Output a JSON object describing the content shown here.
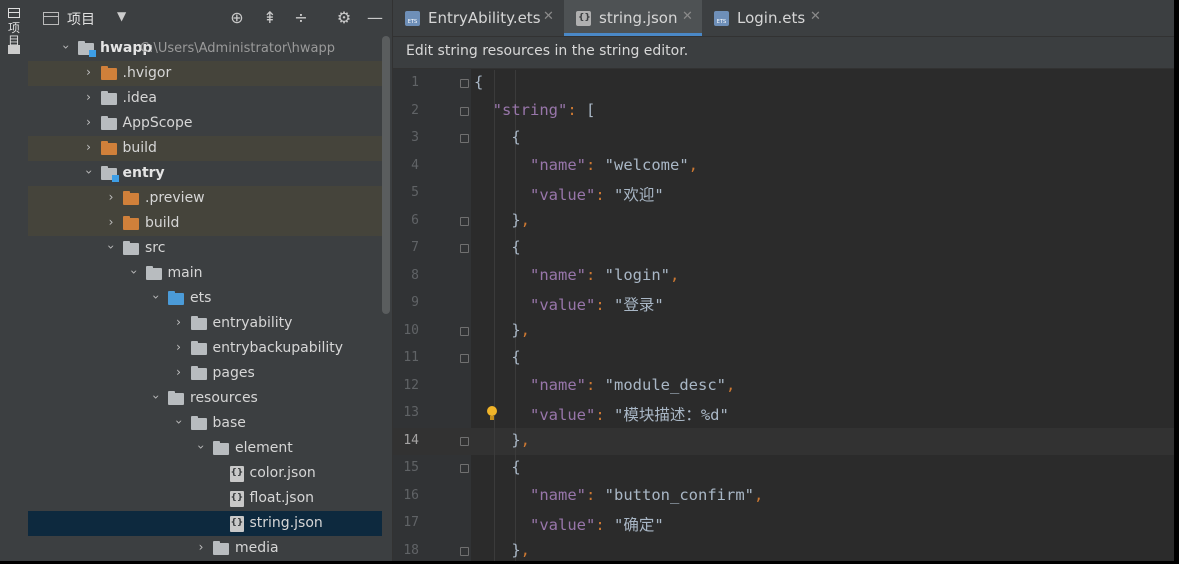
{
  "tool_strip": {
    "label": "项目"
  },
  "project_panel": {
    "title": "项目",
    "toolbar": [
      {
        "name": "locate-icon",
        "glyph": "⊕"
      },
      {
        "name": "expand-all-icon",
        "glyph": "⇞"
      },
      {
        "name": "collapse-all-icon",
        "glyph": "÷"
      },
      {
        "name": "settings-gear-icon",
        "glyph": "⚙"
      },
      {
        "name": "hide-panel-icon",
        "glyph": "—"
      }
    ],
    "tree": [
      {
        "label": "hwapp",
        "path": "C:\\Users\\Administrator\\hwapp",
        "depth": 0,
        "open": true,
        "icon": "mod",
        "bold": true
      },
      {
        "label": ".hvigor",
        "depth": 1,
        "open": false,
        "icon": "orange",
        "hl": true
      },
      {
        "label": ".idea",
        "depth": 1,
        "open": false,
        "icon": "grey"
      },
      {
        "label": "AppScope",
        "depth": 1,
        "open": false,
        "icon": "grey"
      },
      {
        "label": "build",
        "depth": 1,
        "open": false,
        "icon": "orange",
        "hl": true
      },
      {
        "label": "entry",
        "depth": 1,
        "open": true,
        "icon": "mod",
        "bold": true
      },
      {
        "label": ".preview",
        "depth": 2,
        "open": false,
        "icon": "orange",
        "hl": true
      },
      {
        "label": "build",
        "depth": 2,
        "open": false,
        "icon": "orange",
        "hl": true
      },
      {
        "label": "src",
        "depth": 2,
        "open": true,
        "icon": "grey"
      },
      {
        "label": "main",
        "depth": 3,
        "open": true,
        "icon": "grey"
      },
      {
        "label": "ets",
        "depth": 4,
        "open": true,
        "icon": "blue"
      },
      {
        "label": "entryability",
        "depth": 5,
        "open": false,
        "icon": "grey"
      },
      {
        "label": "entrybackupability",
        "depth": 5,
        "open": false,
        "icon": "grey"
      },
      {
        "label": "pages",
        "depth": 5,
        "open": false,
        "icon": "grey"
      },
      {
        "label": "resources",
        "depth": 4,
        "open": true,
        "icon": "grey"
      },
      {
        "label": "base",
        "depth": 5,
        "open": true,
        "icon": "grey"
      },
      {
        "label": "element",
        "depth": 6,
        "open": true,
        "icon": "grey"
      },
      {
        "label": "color.json",
        "depth": 7,
        "file": true
      },
      {
        "label": "float.json",
        "depth": 7,
        "file": true
      },
      {
        "label": "string.json",
        "depth": 7,
        "file": true,
        "selected": true
      },
      {
        "label": "media",
        "depth": 6,
        "open": false,
        "icon": "grey"
      }
    ]
  },
  "tabs": [
    {
      "label": "EntryAbility.ets",
      "icon": "ets",
      "active": false
    },
    {
      "label": "string.json",
      "icon": "json",
      "active": true
    },
    {
      "label": "Login.ets",
      "icon": "ets",
      "active": false
    }
  ],
  "editor": {
    "notice": "Edit string resources in the string editor.",
    "current_line": 14,
    "lines": [
      {
        "n": "1",
        "t": "{",
        "fold": true
      },
      {
        "n": "2",
        "t": "  \"string\": [",
        "fold": true
      },
      {
        "n": "3",
        "t": "    {",
        "fold": true
      },
      {
        "n": "4",
        "t": "      \"name\": \"welcome\","
      },
      {
        "n": "5",
        "t": "      \"value\": \"欢迎\""
      },
      {
        "n": "6",
        "t": "    },",
        "fold": true
      },
      {
        "n": "7",
        "t": "    {",
        "fold": true
      },
      {
        "n": "8",
        "t": "      \"name\": \"login\","
      },
      {
        "n": "9",
        "t": "      \"value\": \"登录\""
      },
      {
        "n": "10",
        "t": "    },",
        "fold": true
      },
      {
        "n": "11",
        "t": "    {",
        "fold": true
      },
      {
        "n": "12",
        "t": "      \"name\": \"module_desc\","
      },
      {
        "n": "13",
        "t": "      \"value\": \"模块描述：%d\"",
        "bulb": true
      },
      {
        "n": "14",
        "t": "    },",
        "fold": true
      },
      {
        "n": "15",
        "t": "    {",
        "fold": true
      },
      {
        "n": "16",
        "t": "      \"name\": \"button_confirm\","
      },
      {
        "n": "17",
        "t": "      \"value\": \"确定\""
      },
      {
        "n": "18",
        "t": "    },",
        "fold": true
      }
    ]
  },
  "colors": {
    "key": "#9876aa",
    "string": "#6a8759",
    "punct": "#cc7832",
    "selection": "#0d293e",
    "accent": "#4a88c7"
  }
}
